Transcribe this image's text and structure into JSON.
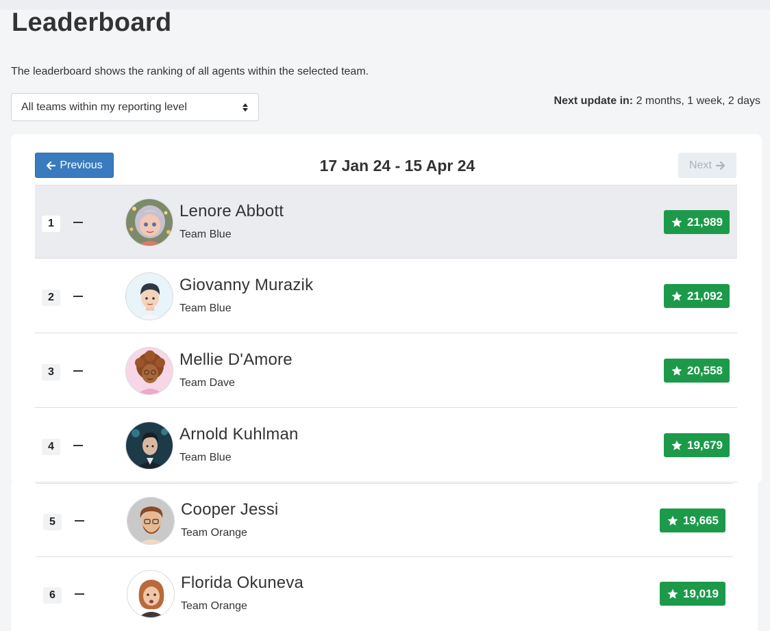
{
  "header": {
    "title": "Leaderboard",
    "description": "The leaderboard shows the ranking of all agents within the selected team."
  },
  "filter": {
    "selected": "All teams within my reporting level"
  },
  "update": {
    "label": "Next update in:",
    "value": "2 months, 1 week, 2 days"
  },
  "pager": {
    "previous_label": "Previous",
    "next_label": "Next",
    "range": "17 Jan 24 - 15 Apr 24"
  },
  "colors": {
    "primary": "#3a7bbf",
    "score": "#1c9a4a",
    "highlight_row": "#ebecef"
  },
  "rows": [
    {
      "rank": "1",
      "name": "Lenore Abbott",
      "team": "Team Blue",
      "score": "21,989",
      "avatar": "girl-avatar"
    },
    {
      "rank": "2",
      "name": "Giovanny Murazik",
      "team": "Team Blue",
      "score": "21,092",
      "avatar": "boy-avatar"
    },
    {
      "rank": "3",
      "name": "Mellie D'Amore",
      "team": "Team Dave",
      "score": "20,558",
      "avatar": "curly-hair-avatar"
    },
    {
      "rank": "4",
      "name": "Arnold Kuhlman",
      "team": "Team Blue",
      "score": "19,679",
      "avatar": "man-suit-avatar"
    },
    {
      "rank": "5",
      "name": "Cooper Jessi",
      "team": "Team Orange",
      "score": "19,665",
      "avatar": "bearded-man-avatar"
    },
    {
      "rank": "6",
      "name": "Florida Okuneva",
      "team": "Team Orange",
      "score": "19,019",
      "avatar": "woman-avatar"
    }
  ]
}
